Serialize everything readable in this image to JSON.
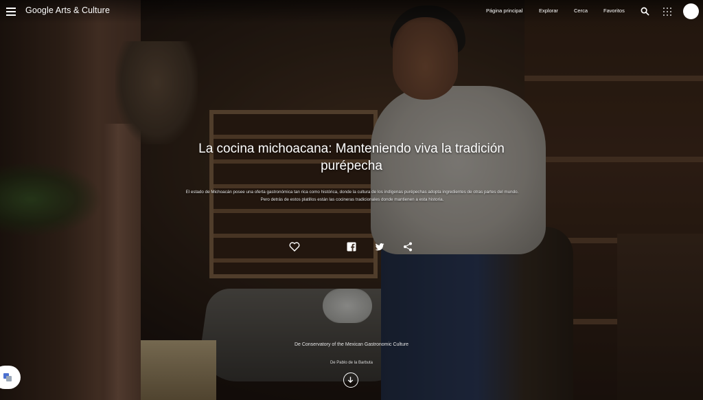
{
  "header": {
    "logo": "Google Arts & Culture",
    "nav": {
      "home": "Página principal",
      "explore": "Explorar",
      "nearby": "Cerca",
      "favorites": "Favoritos"
    }
  },
  "story": {
    "title": "La cocina michoacana: Manteniendo viva la tradición purépecha",
    "description": "El estado de Michoacán posee una oferta gastronómica tan rica como histórica, donde la cultura de los indígenas purépechas adopta ingredientes de otras partes del mundo. Pero detrás de estos platillos están las cocineras tradicionales donde mantienen a esta historia.",
    "credit_org": "De Conservatory of the Mexican Gastronomic Culture",
    "credit_by": "De Pablo de la Barbuta"
  },
  "icons": {
    "menu": "menu-icon",
    "search": "search-icon",
    "apps": "apps-grid-icon",
    "favorite": "heart-icon",
    "facebook": "facebook-icon",
    "twitter": "twitter-icon",
    "share": "share-icon",
    "scroll": "arrow-down-icon",
    "translate": "translate-icon"
  }
}
